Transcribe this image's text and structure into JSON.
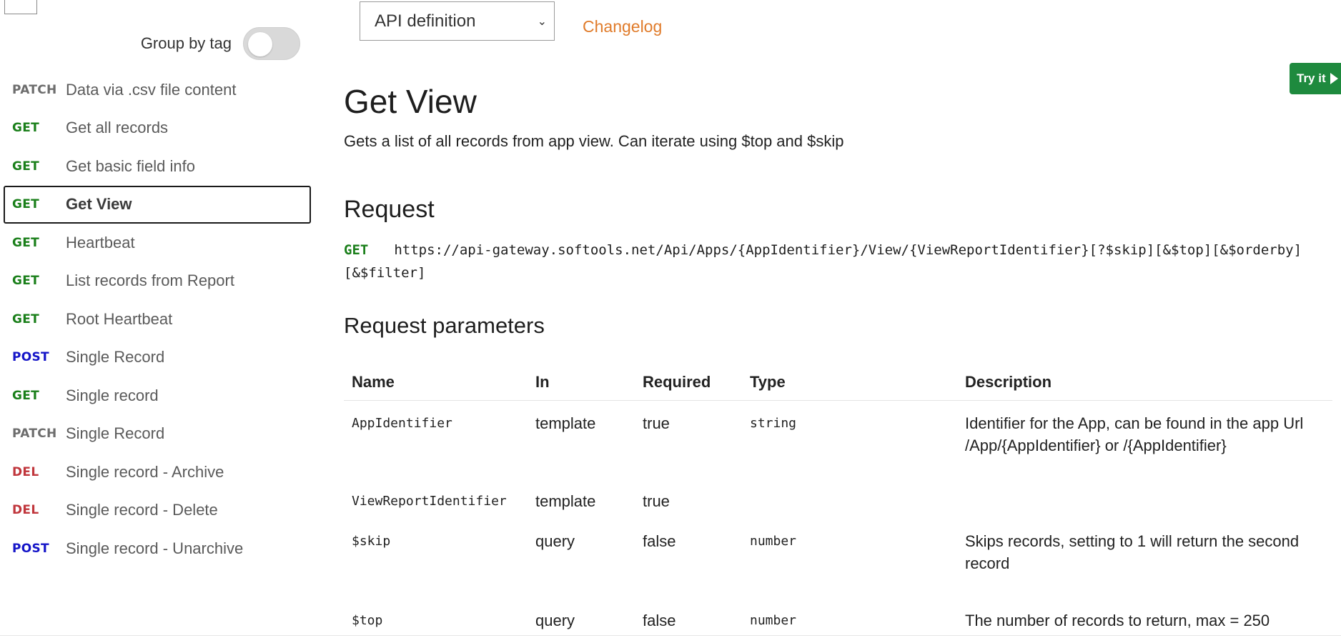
{
  "sidebar": {
    "group_label": "Group by tag",
    "group_toggle_on": false,
    "operations": [
      {
        "method": "PATCH",
        "name": "Data via .csv file content"
      },
      {
        "method": "GET",
        "name": "Get all records"
      },
      {
        "method": "GET",
        "name": "Get basic field info"
      },
      {
        "method": "GET",
        "name": "Get View",
        "active": true
      },
      {
        "method": "GET",
        "name": "Heartbeat"
      },
      {
        "method": "GET",
        "name": "List records from Report"
      },
      {
        "method": "GET",
        "name": "Root Heartbeat"
      },
      {
        "method": "POST",
        "name": "Single Record"
      },
      {
        "method": "GET",
        "name": "Single record"
      },
      {
        "method": "PATCH",
        "name": "Single Record"
      },
      {
        "method": "DEL",
        "name": "Single record - Archive"
      },
      {
        "method": "DEL",
        "name": "Single record - Delete"
      },
      {
        "method": "POST",
        "name": "Single record - Unarchive"
      }
    ]
  },
  "topbar": {
    "api_select_value": "API definition",
    "changelog_label": "Changelog",
    "try_it_label": "Try it"
  },
  "main": {
    "title": "Get View",
    "description": "Gets a list of all records from app view. Can iterate using $top and $skip",
    "request_heading": "Request",
    "request_method": "GET",
    "request_url": "https://api-gateway.softools.net/Api/Apps/{AppIdentifier}/View/{ViewReportIdentifier}[?$skip][&$top][&$orderby][&$filter]",
    "params_heading": "Request parameters",
    "params_columns": [
      "Name",
      "In",
      "Required",
      "Type",
      "Description"
    ],
    "params_rows": [
      {
        "name": "AppIdentifier",
        "in": "template",
        "required": "true",
        "type": "string",
        "description": "Identifier for the App, can be found in the app Url /App/{AppIdentifier} or /{AppIdentifier}"
      },
      {
        "name": "ViewReportIdentifier",
        "in": "template",
        "required": "true",
        "type": "",
        "description": ""
      },
      {
        "name": "$skip",
        "in": "query",
        "required": "false",
        "type": "number",
        "description": "Skips records, setting to 1 will return the second record"
      },
      {
        "name": "$top",
        "in": "query",
        "required": "false",
        "type": "number",
        "description": "The number of records to return, max = 250"
      }
    ]
  },
  "colors": {
    "get": "#1a7f1a",
    "post": "#1515c8",
    "patch": "#6d6d6d",
    "del": "#c0363c",
    "changelog": "#e07b2a",
    "try_it_bg": "#1e8a3e"
  },
  "icons": {
    "select_chevron": "chevron-down-icon",
    "try_it": "play-icon"
  }
}
